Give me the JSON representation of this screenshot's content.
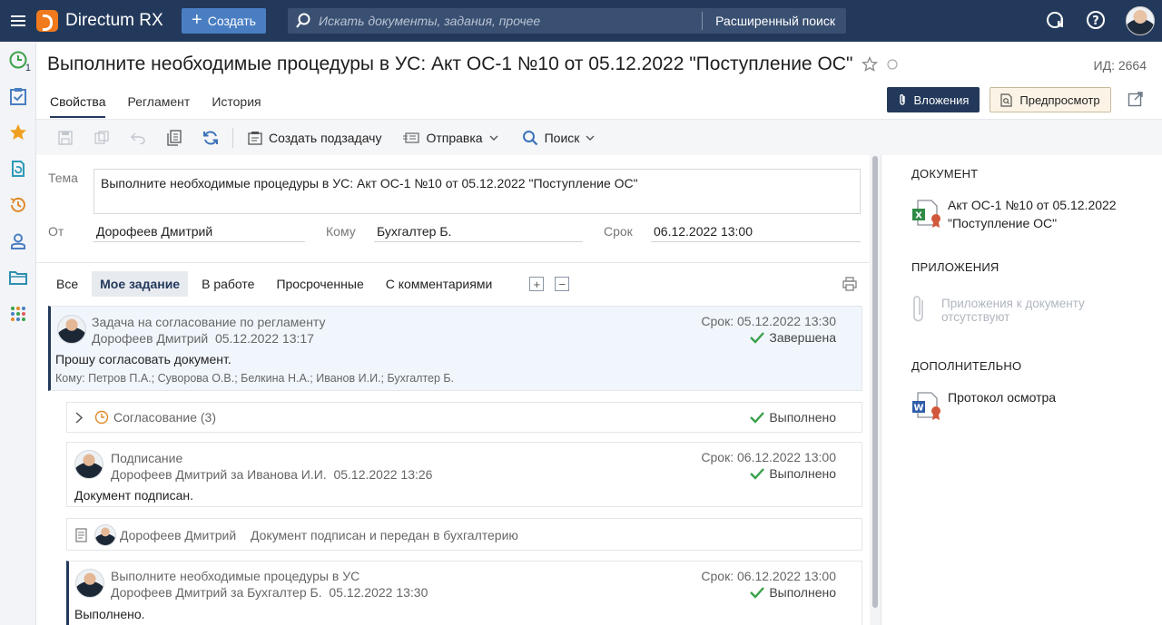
{
  "topbar": {
    "app_name": "Directum RX",
    "create_label": "Создать",
    "search_placeholder": "Искать документы, задания, прочее",
    "advanced_search": "Расширенный поиск"
  },
  "rail": {
    "badge_count": "1"
  },
  "header": {
    "title": "Выполните необходимые процедуры в УС: Акт ОС-1 №10 от 05.12.2022 \"Поступление ОС\"",
    "id_label": "ИД: 2664",
    "tabs": [
      "Свойства",
      "Регламент",
      "История"
    ],
    "attachments_label": "Вложения",
    "preview_label": "Предпросмотр"
  },
  "toolbar": {
    "create_subtask": "Создать подзадачу",
    "send": "Отправка",
    "search": "Поиск"
  },
  "form": {
    "subject_label": "Тема",
    "subject_value": "Выполните необходимые процедуры в УС: Акт ОС-1 №10 от 05.12.2022 \"Поступление ОС\"",
    "from_label": "От",
    "from_value": "Дорофеев Дмитрий",
    "to_label": "Кому",
    "to_value": "Бухгалтер Б.",
    "deadline_label": "Срок",
    "deadline_value": "06.12.2022 13:00"
  },
  "filters": [
    "Все",
    "Мое задание",
    "В работе",
    "Просроченные",
    "С комментариями"
  ],
  "thread": {
    "main": {
      "title": "Задача на согласование по регламенту",
      "author": "Дорофеев Дмитрий",
      "date": "05.12.2022 13:17",
      "deadline": "Срок: 05.12.2022 13:30",
      "status": "Завершена",
      "text": "Прошу согласовать документ.",
      "recipients": "Кому: Петров П.А.; Суворова О.В.; Белкина Н.А.; Иванов И.И.; Бухгалтер Б."
    },
    "approval": {
      "title": "Согласование (3)",
      "status": "Выполнено"
    },
    "sign": {
      "title": "Подписание",
      "author": "Дорофеев Дмитрий за Иванова И.И.",
      "date": "05.12.2022 13:26",
      "deadline": "Срок: 06.12.2022 13:00",
      "status": "Выполнено",
      "text": "Документ подписан."
    },
    "note": {
      "author": "Дорофеев Дмитрий",
      "text": "Документ подписан и передан в бухгалтерию"
    },
    "proc": {
      "title": "Выполните необходимые процедуры в УС",
      "author": "Дорофеев Дмитрий за Бухгалтер Б.",
      "date": "05.12.2022 13:30",
      "deadline": "Срок: 06.12.2022 13:00",
      "status": "Выполнено",
      "text": "Выполнено."
    }
  },
  "right_panel": {
    "document_head": "ДОКУМЕНТ",
    "document_line1": "Акт ОС-1 №10 от 05.12.2022",
    "document_line2": "\"Поступление ОС\"",
    "attachments_head": "ПРИЛОЖЕНИЯ",
    "attachments_empty_line1": "Приложения к документу",
    "attachments_empty_line2": "отсутствуют",
    "extra_head": "ДОПОЛНИТЕЛЬНО",
    "extra_doc": "Протокол осмотра"
  },
  "colors": {
    "topbar": "#23395b",
    "accent": "#4a7ec2",
    "logo": "#f07a1c",
    "success": "#3aa14a"
  }
}
